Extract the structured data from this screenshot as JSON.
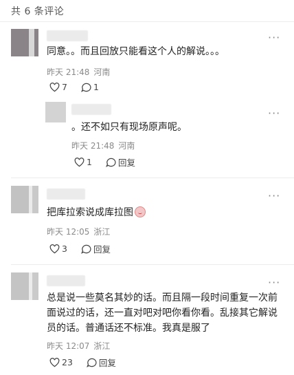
{
  "header": {
    "title": "共 6 条评论"
  },
  "comments": [
    {
      "text": "同意。。而且回放只能看这个人的解说。。。",
      "time": "昨天 21:48",
      "location": "河南",
      "likes": "7",
      "replies_count": "1",
      "reply": {
        "text": "。还不如只有现场原声呢。",
        "time": "昨天 21:48",
        "location": "河南",
        "likes": "1",
        "reply_label": "回复"
      }
    },
    {
      "text": "把库拉索说成库拉图",
      "emoji": "crying-laughing-emoji",
      "time": "昨天 12:05",
      "location": "浙江",
      "likes": "3",
      "reply_label": "回复"
    },
    {
      "text_lines": [
        "总是说一些莫名其妙的话。而且隔一段时间重复一次前",
        "面说过的话，还一直对吧对吧你看你看。乱接其它解说",
        "员的话。普通话还不标准。我真是服了"
      ],
      "time": "昨天 12:07",
      "location": "浙江",
      "likes": "23",
      "reply_label": "回复"
    }
  ],
  "more_label": "···",
  "colors": {
    "text": "#222222",
    "meta": "#8a8a8a",
    "divider": "#ececec"
  },
  "icons": {
    "like": "heart-outline-icon",
    "comment": "speech-bubble-icon",
    "more": "more-dots-icon"
  }
}
